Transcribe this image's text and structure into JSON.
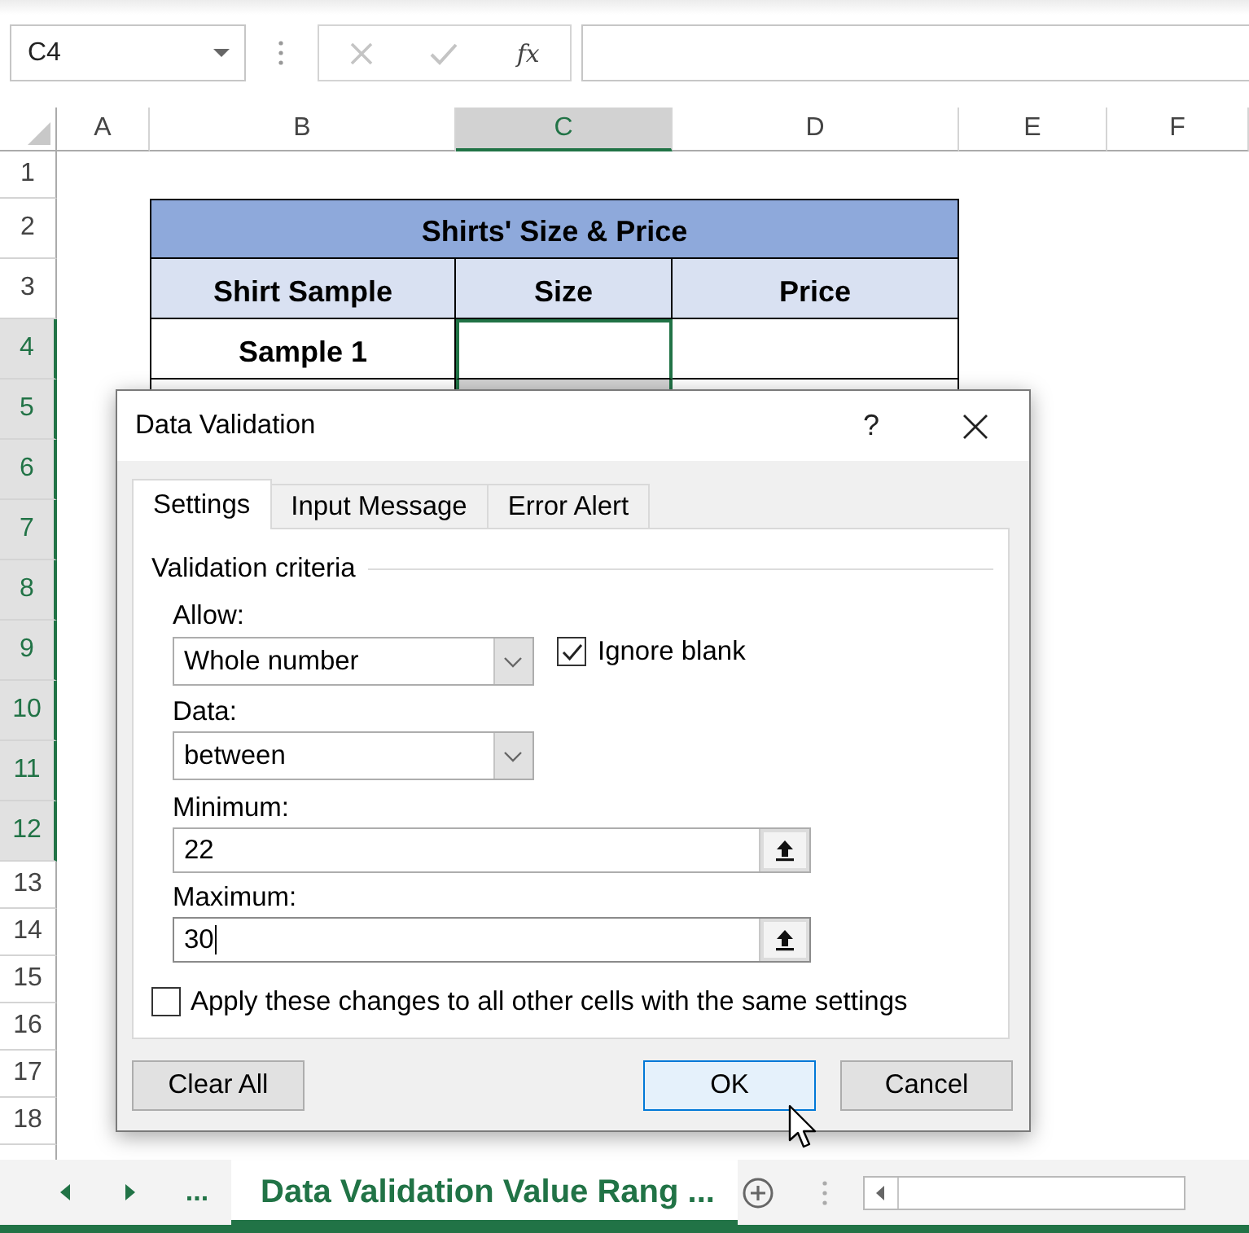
{
  "name_box": {
    "value": "C4"
  },
  "formula_bar": {
    "buttons": [
      {
        "kind": "cancel",
        "disabled": true
      },
      {
        "kind": "enter",
        "disabled": true
      },
      {
        "kind": "function",
        "label": "fx",
        "disabled": false
      }
    ]
  },
  "columns": [
    {
      "label": "A",
      "selected": false
    },
    {
      "label": "B",
      "selected": false
    },
    {
      "label": "C",
      "selected": true
    },
    {
      "label": "D",
      "selected": false
    },
    {
      "label": "E",
      "selected": false
    },
    {
      "label": "F",
      "selected": false
    }
  ],
  "rows": [
    {
      "label": "1",
      "selected": false
    },
    {
      "label": "2",
      "selected": false
    },
    {
      "label": "3",
      "selected": false
    },
    {
      "label": "4",
      "selected": true
    },
    {
      "label": "5",
      "selected": true
    },
    {
      "label": "6",
      "selected": true
    },
    {
      "label": "7",
      "selected": true
    },
    {
      "label": "8",
      "selected": true
    },
    {
      "label": "9",
      "selected": true
    },
    {
      "label": "10",
      "selected": true
    },
    {
      "label": "11",
      "selected": true
    },
    {
      "label": "12",
      "selected": true
    },
    {
      "label": "13",
      "selected": false
    },
    {
      "label": "14",
      "selected": false
    },
    {
      "label": "15",
      "selected": false
    },
    {
      "label": "16",
      "selected": false
    },
    {
      "label": "17",
      "selected": false
    },
    {
      "label": "18",
      "selected": false
    }
  ],
  "table": {
    "title": "Shirts' Size & Price",
    "headers": [
      "Shirt Sample",
      "Size",
      "Price"
    ],
    "rows": [
      {
        "cells": [
          {
            "text": "Sample 1",
            "active": false
          },
          {
            "active": true
          },
          {
            "active": false
          }
        ]
      }
    ]
  },
  "dialog": {
    "title": "Data Validation",
    "help_label": "?",
    "tabs": [
      {
        "label": "Settings",
        "selected": true
      },
      {
        "label": "Input Message",
        "selected": false
      },
      {
        "label": "Error Alert",
        "selected": false
      }
    ],
    "group_label": "Validation criteria",
    "allow": {
      "label": "Allow:",
      "value": "Whole number"
    },
    "ignore_blank": {
      "label": "Ignore blank",
      "checked": true
    },
    "data": {
      "label": "Data:",
      "value": "between"
    },
    "minimum": {
      "label": "Minimum:",
      "value": "22",
      "focused": false
    },
    "maximum": {
      "label": "Maximum:",
      "value": "30",
      "focused": true
    },
    "apply_all": {
      "label": "Apply these changes to all other cells with the same settings",
      "checked": false
    },
    "buttons": [
      {
        "label": "Clear All",
        "default": false
      },
      {
        "label": "OK",
        "default": true
      },
      {
        "label": "Cancel",
        "default": false
      }
    ]
  },
  "sheet_tabs": {
    "overflow_label": "...",
    "tabs": [
      {
        "label": "Data Validation Value Rang ...",
        "selected": true
      }
    ]
  }
}
